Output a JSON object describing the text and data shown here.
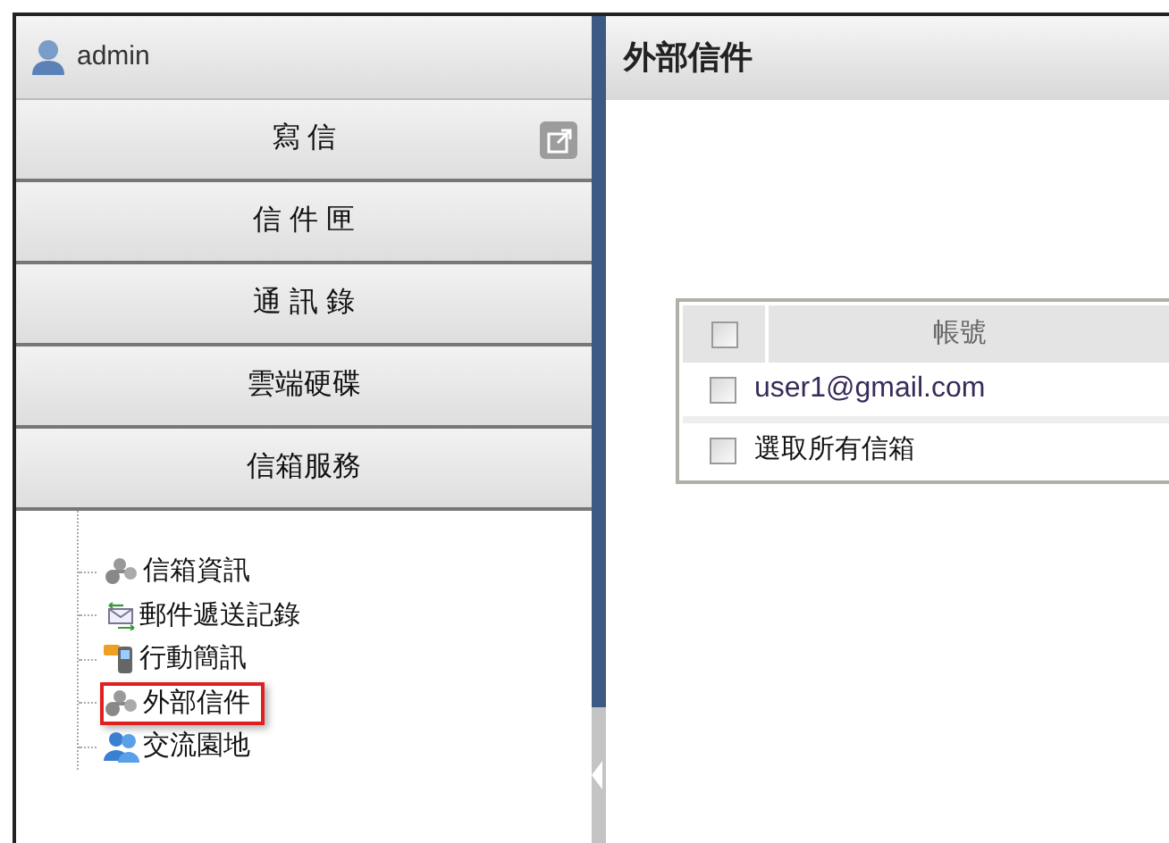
{
  "user": {
    "name": "admin"
  },
  "menu": [
    {
      "label": "寫 信",
      "popout": true
    },
    {
      "label": "信 件 匣",
      "popout": false
    },
    {
      "label": "通 訊 錄",
      "popout": false
    },
    {
      "label": "雲端硬碟",
      "popout": false
    },
    {
      "label": "信箱服務",
      "popout": false
    }
  ],
  "tree": [
    {
      "label": "信箱資訊",
      "selected": false
    },
    {
      "label": "郵件遞送記錄",
      "selected": false
    },
    {
      "label": "行動簡訊",
      "selected": false
    },
    {
      "label": "外部信件",
      "selected": true
    },
    {
      "label": "交流園地",
      "selected": false
    }
  ],
  "page": {
    "title": "外部信件"
  },
  "table": {
    "header": {
      "label": "帳號",
      "checked": false
    },
    "rows": [
      {
        "account": "user1@gmail.com",
        "checked": false
      }
    ],
    "select_all": {
      "label": "選取所有信箱",
      "checked": false
    }
  }
}
